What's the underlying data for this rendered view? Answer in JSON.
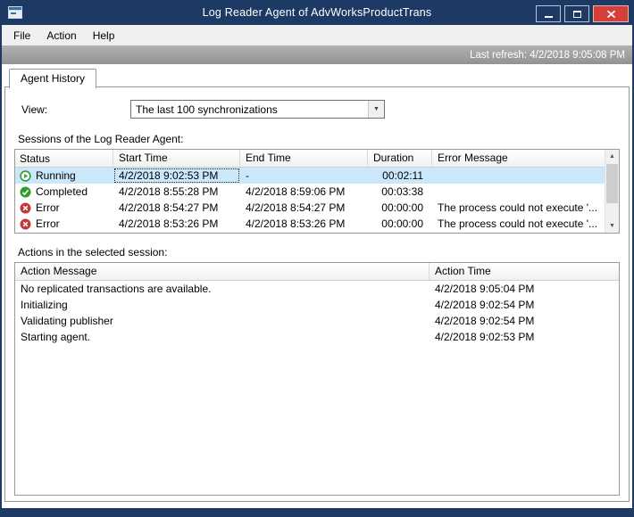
{
  "window": {
    "title": "Log Reader Agent of AdvWorksProductTrans"
  },
  "menu": {
    "items": [
      {
        "label": "File"
      },
      {
        "label": "Action"
      },
      {
        "label": "Help"
      }
    ]
  },
  "status_strip": {
    "last_refresh": "Last refresh: 4/2/2018 9:05:08 PM"
  },
  "tabs": [
    {
      "label": "Agent History"
    }
  ],
  "view": {
    "label": "View:",
    "value": "The last 100 synchronizations"
  },
  "icons": {
    "dropdown_arrow": "▼",
    "scroll_up": "▲",
    "scroll_down": "▼"
  },
  "colors": {
    "titlebar": "#1c3a63",
    "close_button": "#d43f3a",
    "selection": "#cbe8fb",
    "status_strip_text": "#ffffff",
    "running_icon": "#2f9e2f",
    "completed_icon": "#2e9e2e",
    "error_icon": "#c63838"
  },
  "sessions": {
    "label": "Sessions of the Log Reader Agent:",
    "columns": [
      "Status",
      "Start Time",
      "End Time",
      "Duration",
      "Error Message"
    ],
    "rows": [
      {
        "icon": "running-icon",
        "status": "Running",
        "start": "4/2/2018 9:02:53 PM",
        "end": "-",
        "duration": "00:02:11",
        "error": ""
      },
      {
        "icon": "completed-icon",
        "status": "Completed",
        "start": "4/2/2018 8:55:28 PM",
        "end": "4/2/2018 8:59:06 PM",
        "duration": "00:03:38",
        "error": ""
      },
      {
        "icon": "error-icon",
        "status": "Error",
        "start": "4/2/2018 8:54:27 PM",
        "end": "4/2/2018 8:54:27 PM",
        "duration": "00:00:00",
        "error": "The process could not execute '..."
      },
      {
        "icon": "error-icon",
        "status": "Error",
        "start": "4/2/2018 8:53:26 PM",
        "end": "4/2/2018 8:53:26 PM",
        "duration": "00:00:00",
        "error": "The process could not execute '..."
      }
    ]
  },
  "actions": {
    "label": "Actions in the selected session:",
    "columns": [
      "Action Message",
      "Action Time"
    ],
    "rows": [
      {
        "message": "No replicated transactions are available.",
        "time": "4/2/2018 9:05:04 PM"
      },
      {
        "message": "Initializing",
        "time": "4/2/2018 9:02:54 PM"
      },
      {
        "message": "Validating publisher",
        "time": "4/2/2018 9:02:54 PM"
      },
      {
        "message": "Starting agent.",
        "time": "4/2/2018 9:02:53 PM"
      }
    ]
  }
}
